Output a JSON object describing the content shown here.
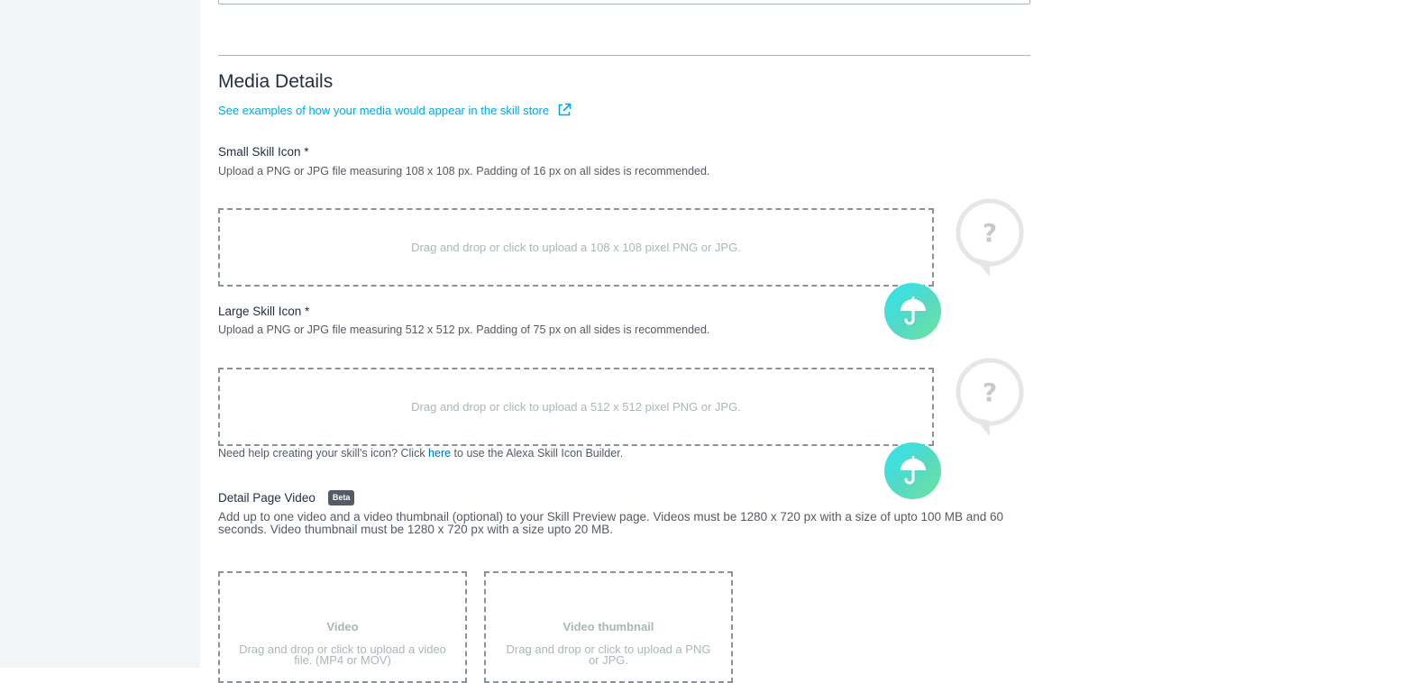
{
  "media": {
    "title": "Media Details",
    "examples_link": "See examples of how your media would appear in the skill store",
    "small_icon": {
      "label": "Small Skill Icon *",
      "help": "Upload a PNG or JPG file measuring 108 x 108 px. Padding of 16 px on all sides is recommended.",
      "dropzone": "Drag and drop or click to upload a 108 x 108 pixel PNG or JPG."
    },
    "large_icon": {
      "label": "Large Skill Icon *",
      "help": "Upload a PNG or JPG file measuring 512 x 512 px. Padding of 75 px on all sides is recommended.",
      "dropzone": "Drag and drop or click to upload a 512 x 512 pixel PNG or JPG."
    },
    "icon_builder": {
      "prefix": "Need help creating your skill's icon? Click ",
      "link": "here",
      "suffix": " to use the Alexa Skill Icon Builder."
    },
    "video": {
      "label": "Detail Page Video",
      "badge": "Beta",
      "help": "Add up to one video and a video thumbnail (optional) to your Skill Preview page. Videos must be 1280 x 720 px with a size of upto 100 MB and 60 seconds. Video thumbnail must be 1280 x 720 px with a size upto 20 MB.",
      "video_box": {
        "title": "Video",
        "desc": "Drag and drop or click to upload a video file. (MP4 or MOV)"
      },
      "thumbnail_box": {
        "title": "Video thumbnail",
        "desc": "Drag and drop or click to upload a PNG or JPG."
      }
    },
    "placeholder_glyph": "?"
  },
  "colors": {
    "link": "#00a8e1",
    "help_link": "#0073bb",
    "dashed_border": "#879596",
    "float_button_gradient": [
      "#2ee5f0",
      "#6ee59c"
    ],
    "left_rail": "#f2f6f7"
  },
  "icons": {
    "external_link": "external-link-icon",
    "placeholder": "speech-bubble-question-icon",
    "float_button": "umbrella-icon"
  }
}
